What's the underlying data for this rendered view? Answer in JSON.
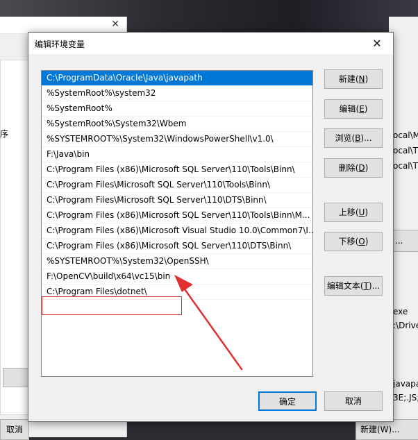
{
  "dialog": {
    "title": "编辑环境变量",
    "close_glyph": "✕"
  },
  "path_entries": [
    {
      "text": "C:\\ProgramData\\Oracle\\Java\\javapath",
      "selected": true
    },
    {
      "text": "%SystemRoot%\\system32"
    },
    {
      "text": "%SystemRoot%"
    },
    {
      "text": "%SystemRoot%\\System32\\Wbem"
    },
    {
      "text": "%SYSTEMROOT%\\System32\\WindowsPowerShell\\v1.0\\"
    },
    {
      "text": "F:\\Java\\bin"
    },
    {
      "text": "C:\\Program Files (x86)\\Microsoft SQL Server\\110\\Tools\\Binn\\"
    },
    {
      "text": "C:\\Program Files\\Microsoft SQL Server\\110\\Tools\\Binn\\"
    },
    {
      "text": "C:\\Program Files\\Microsoft SQL Server\\110\\DTS\\Binn\\"
    },
    {
      "text": "C:\\Program Files (x86)\\Microsoft SQL Server\\110\\Tools\\Binn\\M..."
    },
    {
      "text": "C:\\Program Files (x86)\\Microsoft Visual Studio 10.0\\Common7\\I..."
    },
    {
      "text": "C:\\Program Files (x86)\\Microsoft SQL Server\\110\\DTS\\Binn\\"
    },
    {
      "text": "%SYSTEMROOT%\\System32\\OpenSSH\\"
    },
    {
      "text": "F:\\OpenCV\\build\\x64\\vc15\\bin",
      "highlighted": true
    },
    {
      "text": "C:\\Program Files\\dotnet\\"
    }
  ],
  "buttons": {
    "new": {
      "label": "新建(",
      "key": "N",
      "tail": ")"
    },
    "edit": {
      "label": "编辑(",
      "key": "E",
      "tail": ")"
    },
    "browse": {
      "label": "浏览(",
      "key": "B",
      "tail": ")..."
    },
    "delete": {
      "label": "删除(",
      "key": "D",
      "tail": ")"
    },
    "move_up": {
      "label": "上移(",
      "key": "U",
      "tail": ")"
    },
    "move_down": {
      "label": "下移(",
      "key": "O",
      "tail": ")"
    },
    "edit_text": {
      "label": "编辑文本(",
      "key": "T",
      "tail": ")..."
    },
    "ok": "确定",
    "cancel": "取消"
  },
  "background": {
    "left_fragment": "序",
    "left_cancel": "取消",
    "right_rows": [
      "ocal\\M",
      "ocal\\T",
      "ocal\\T"
    ],
    "right_dots": "...",
    "right_lower": [
      "exe",
      ":\\Drive"
    ],
    "right_bottom": [
      "javapa",
      "3E;.JS;."
    ],
    "right_new": "新建(W)..."
  },
  "colors": {
    "selection": "#0078d7",
    "annotation": "#e03030"
  }
}
